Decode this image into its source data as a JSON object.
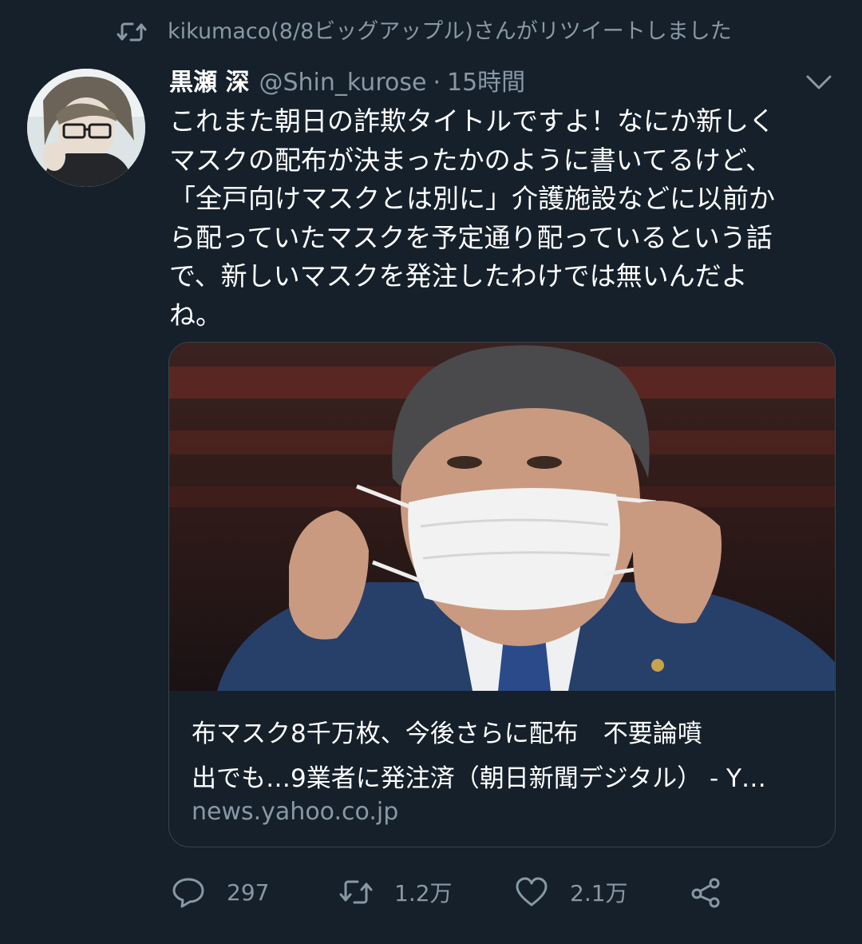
{
  "retweet_context": {
    "text": "kikumaco(8/8ビッグアップル)さんがリツイートしました",
    "icon": "retweet-icon"
  },
  "tweet": {
    "author_name": "黒瀬 深",
    "author_handle": "@Shin_kurose",
    "separator": "·",
    "time": "15時間",
    "text_lines": [
      "これまた朝日の詐欺タイトルですよ！なにか新しく",
      "マスクの配布が決まったかのように書いてるけど、",
      "「全戸向けマスクとは別に」介護施設などに以前か",
      "ら配っていたマスクを予定通り配っているという話",
      "で、新しいマスクを発注したわけでは無いんだよ",
      "ね。"
    ]
  },
  "card": {
    "title_lines": [
      "布マスク8千万枚、今後さらに配布　不要論噴",
      "出でも…9業者に発注済（朝日新聞デジタル） - Y…"
    ],
    "domain": "news.yahoo.co.jp"
  },
  "actions": {
    "reply_count": "297",
    "retweet_count": "1.2万",
    "like_count": "2.1万"
  },
  "colors": {
    "background": "#15202b",
    "secondary_text": "#8899a6",
    "border": "#38444d"
  }
}
